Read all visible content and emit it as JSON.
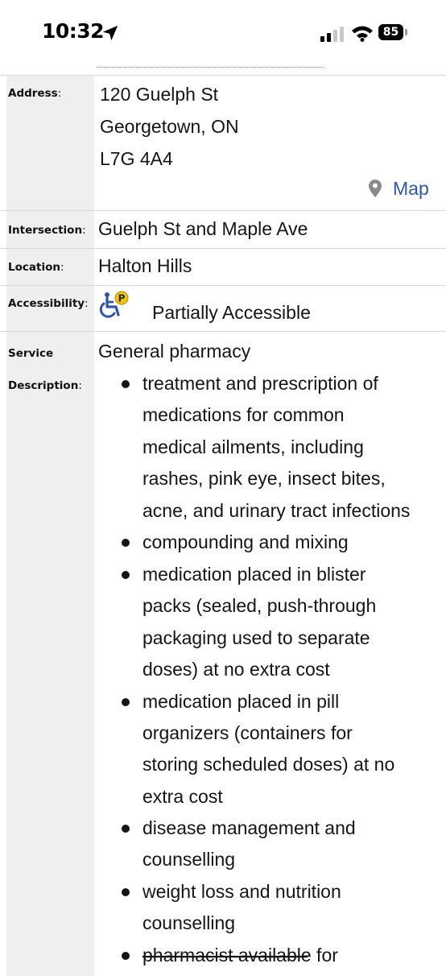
{
  "status_bar": {
    "time": "10:32",
    "battery": "85"
  },
  "rows": {
    "address": {
      "label": "Address",
      "lines": [
        "120 Guelph St",
        "Georgetown, ON",
        "L7G 4A4"
      ],
      "map_link": "Map"
    },
    "intersection": {
      "label": "Intersection",
      "value": "Guelph St and Maple Ave"
    },
    "location": {
      "label": "Location",
      "value": "Halton Hills"
    },
    "accessibility": {
      "label": "Accessibility",
      "value": "Partially Accessible"
    },
    "service_description": {
      "label_line1": "Service",
      "label_line2": "Description",
      "intro": "General pharmacy",
      "items": [
        [
          "treatment and prescription of",
          "medications for common",
          "medical ailments, including",
          "rashes, pink eye, insect bites,",
          "acne, and urinary tract infections"
        ],
        [
          "compounding and mixing"
        ],
        [
          "medication placed in blister",
          "packs (sealed, push-through",
          "packaging used to separate",
          "doses) at no extra cost"
        ],
        [
          "medication placed in pill",
          "organizers (containers for",
          "storing scheduled doses) at no",
          "extra cost"
        ],
        [
          "disease management and",
          "counselling"
        ],
        [
          "weight loss and nutrition",
          "counselling"
        ],
        [
          "pharmacist available for"
        ]
      ]
    }
  },
  "colors": {
    "label_background": "#efefef",
    "link": "#2e58a6",
    "divider": "#d9d9d9",
    "accessibility_badge": "#f2c511"
  },
  "icons": [
    "location-arrow-icon",
    "signal-icon",
    "wifi-icon",
    "battery-icon",
    "map-pin-icon",
    "wheelchair-icon"
  ]
}
